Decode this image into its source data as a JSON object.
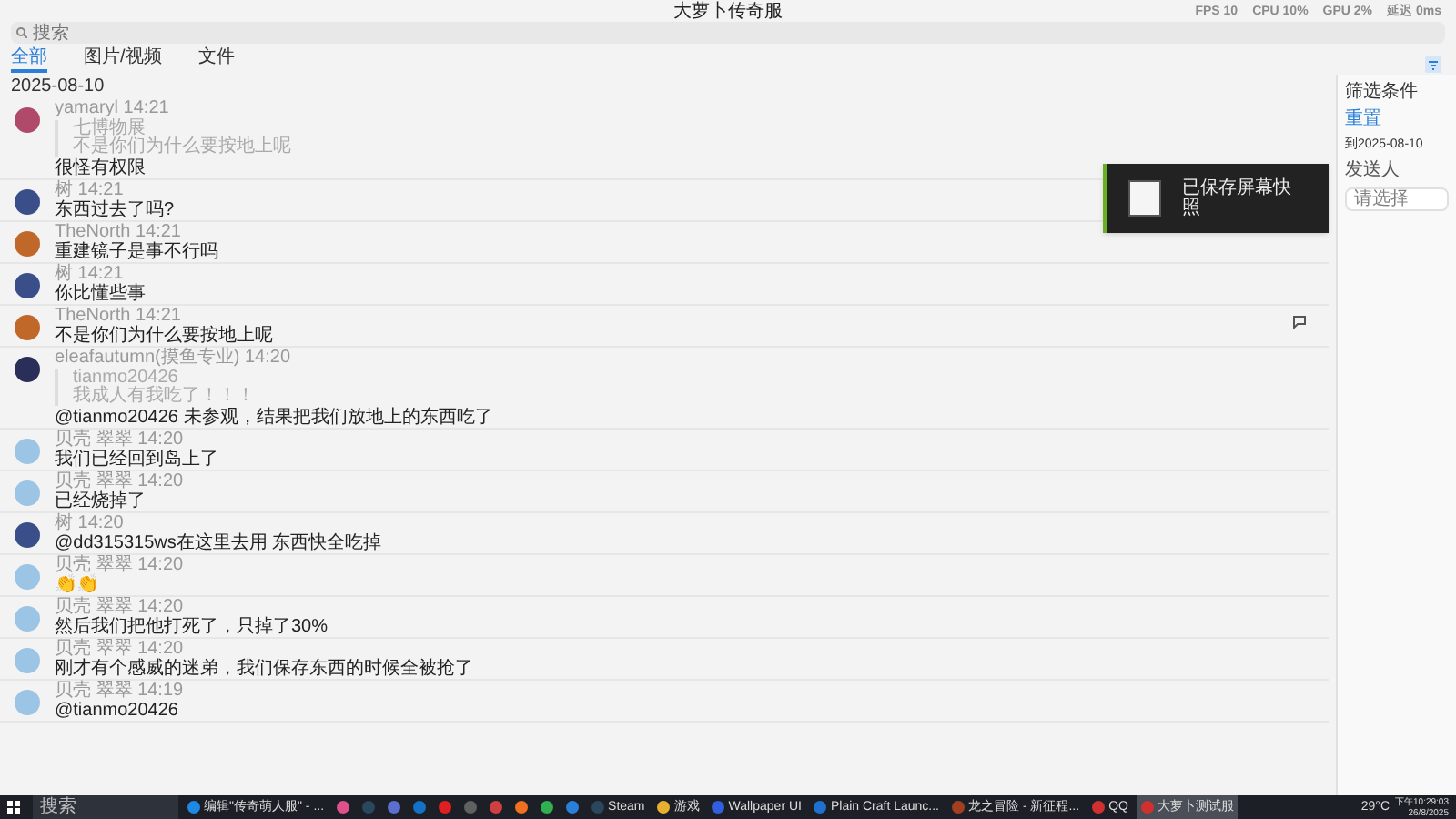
{
  "window": {
    "title": "大萝卜传奇服"
  },
  "overlay_stats": [
    "FPS 10",
    "CPU 10%",
    "GPU 2%",
    "延迟 0ms"
  ],
  "search": {
    "placeholder": "搜索"
  },
  "tabs": [
    {
      "label": "全部",
      "selected": true
    },
    {
      "label": "图片/视频",
      "selected": false
    },
    {
      "label": "文件",
      "selected": false
    }
  ],
  "date": "2025-08-10",
  "messages": [
    {
      "sender": "yamaryl",
      "time": "14:21",
      "color": "#b04a6a",
      "quote": [
        "七博物展",
        "不是你们为什么要按地上呢"
      ],
      "text": "很怪有权限",
      "hovered": false
    },
    {
      "sender": "树",
      "time": "14:21",
      "color": "#3a4f8a",
      "text": "东西过去了吗?",
      "hovered": false
    },
    {
      "sender": "TheNorth",
      "time": "14:21",
      "color": "#c0682a",
      "text": "重建镜子是事不行吗",
      "hovered": false
    },
    {
      "sender": "树",
      "time": "14:21",
      "color": "#3a4f8a",
      "text": "你比懂些事",
      "hovered": false
    },
    {
      "sender": "TheNorth",
      "time": "14:21",
      "color": "#c0682a",
      "text": "不是你们为什么要按地上呢",
      "hovered": true
    },
    {
      "sender": "eleafautumn(摸鱼专业)",
      "time": "14:20",
      "color": "#2a2f5a",
      "quote": [
        "tianmo20426",
        "我成人有我吃了！！！"
      ],
      "text": "@tianmo20426 未参观，结果把我们放地上的东西吃了",
      "hovered": false
    },
    {
      "sender": "贝壳 翠翠",
      "time": "14:20",
      "color": "#9cc4e4",
      "text": "我们已经回到岛上了",
      "hovered": false
    },
    {
      "sender": "贝壳 翠翠",
      "time": "14:20",
      "color": "#9cc4e4",
      "text": "已经烧掉了",
      "hovered": false
    },
    {
      "sender": "树",
      "time": "14:20",
      "color": "#3a4f8a",
      "text": "@dd315315ws在这里去用 东西快全吃掉",
      "hovered": false
    },
    {
      "sender": "贝壳 翠翠",
      "time": "14:20",
      "color": "#9cc4e4",
      "text": "👏👏",
      "hovered": false
    },
    {
      "sender": "贝壳 翠翠",
      "time": "14:20",
      "color": "#9cc4e4",
      "text": "然后我们把他打死了，只掉了30%",
      "hovered": false
    },
    {
      "sender": "贝壳 翠翠",
      "time": "14:20",
      "color": "#9cc4e4",
      "text": "刚才有个感威的迷弟，我们保存东西的时候全被抢了",
      "hovered": false
    },
    {
      "sender": "贝壳 翠翠",
      "time": "14:19",
      "color": "#9cc4e4",
      "text": "@tianmo20426",
      "hovered": false
    }
  ],
  "filter_panel": {
    "title": "筛选条件",
    "reset": "重置",
    "date": "到2025-08-10",
    "sender_label": "发送人",
    "sender_placeholder": "请选择"
  },
  "toast": {
    "text": "已保存屏幕快照"
  },
  "taskbar": {
    "search": "搜索",
    "items": [
      {
        "label": "编辑\"传奇萌人服\" - ...",
        "color": "#1e88e5",
        "active": false
      },
      {
        "color": "#e0508a",
        "active": false
      },
      {
        "color": "#2a475e",
        "active": false
      },
      {
        "color": "#5a6fd0",
        "active": false
      },
      {
        "color": "#1570c8",
        "active": false
      },
      {
        "color": "#e02020",
        "active": false
      },
      {
        "color": "#606060",
        "active": false
      },
      {
        "color": "#d04040",
        "active": false
      },
      {
        "color": "#f07020",
        "active": false
      },
      {
        "color": "#30b050",
        "active": false
      },
      {
        "color": "#2a7fd8",
        "active": false
      },
      {
        "label": "Steam",
        "color": "#2a475e",
        "active": false
      },
      {
        "label": "游戏",
        "color": "#e8b030",
        "active": false
      },
      {
        "label": "Wallpaper UI",
        "color": "#3060e0",
        "active": false
      },
      {
        "label": "Plain Craft Launc...",
        "color": "#2070d0",
        "active": false
      },
      {
        "label": "龙之冒险 - 新征程...",
        "color": "#a04020",
        "active": false
      },
      {
        "label": "QQ",
        "color": "#d03030",
        "active": false
      },
      {
        "label": "大萝卜测试服",
        "color": "#d03030",
        "active": true
      }
    ],
    "weather": "29°C",
    "time": "下午10:29:03",
    "day": "26/8/2025"
  }
}
